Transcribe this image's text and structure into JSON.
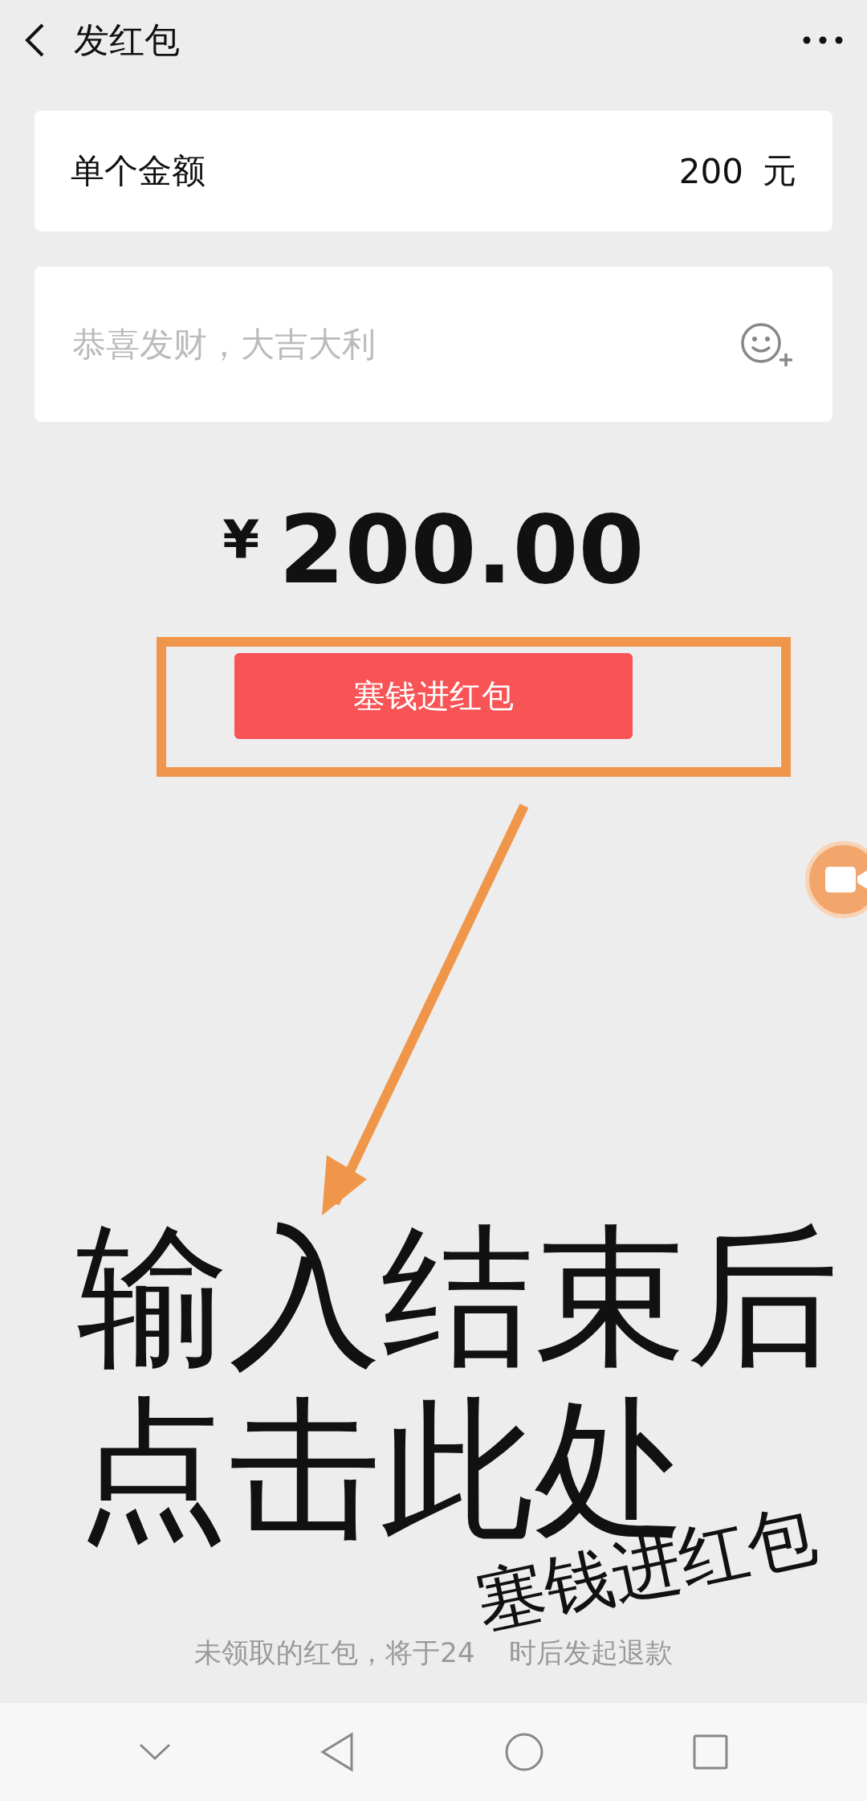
{
  "header": {
    "title": "发红包"
  },
  "amount_field": {
    "label": "单个金额",
    "value": "200",
    "unit": "元"
  },
  "greeting_field": {
    "placeholder": "恭喜发财，大吉大利"
  },
  "total": {
    "currency": "¥",
    "amount": "200.00"
  },
  "submit_button": "塞钱进红包",
  "annotation": {
    "instruction_lines": [
      "输入结束后",
      "点击此处"
    ],
    "handwritten_label": "塞钱进红包"
  },
  "footer_note_parts": [
    "未领取的红包，将于24",
    "时后发起退款"
  ]
}
